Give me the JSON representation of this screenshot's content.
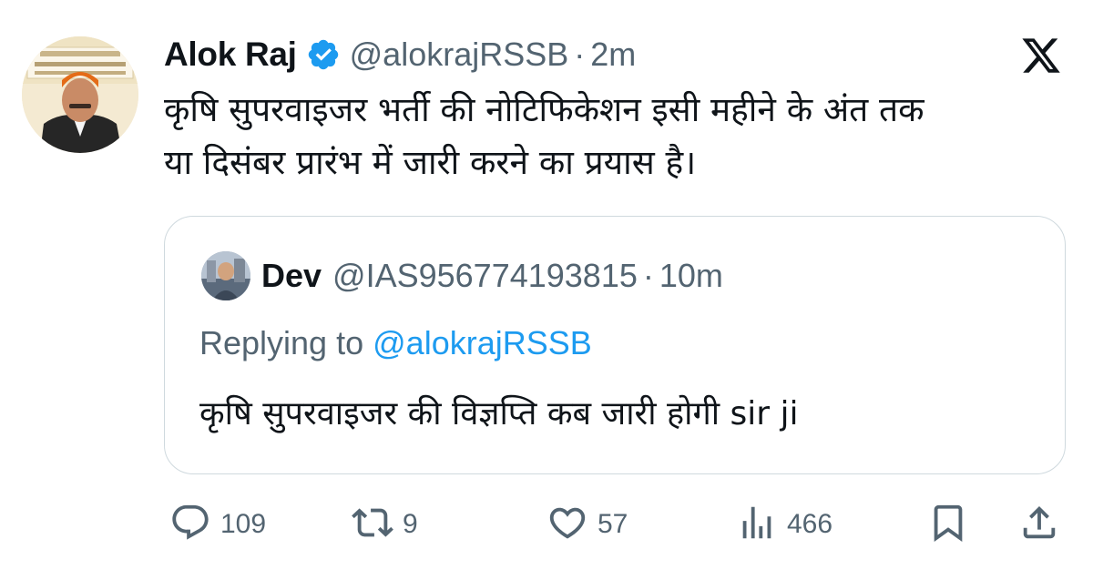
{
  "tweet": {
    "author_name": "Alok Raj",
    "handle": "@alokrajRSSB",
    "separator": "·",
    "time": "2m",
    "text_line1": "कृषि सुपरवाइजर भर्ती की नोटिफिकेशन इसी महीने के अंत तक",
    "text_line2": "या दिसंबर प्रारंभ में जारी करने का प्रयास है।"
  },
  "quoted": {
    "author_name": "Dev",
    "handle": "@IAS956774193815",
    "separator": "·",
    "time": "10m",
    "replying_prefix": "Replying to",
    "replying_handle": "@alokrajRSSB",
    "text": "कृषि सुपरवाइजर की विज्ञप्ति कब जारी होगी sir ji"
  },
  "actions": {
    "replies": "109",
    "reposts": "9",
    "likes": "57",
    "views": "466"
  },
  "icons": {
    "verified": "verified-badge-icon",
    "platform": "x-logo-icon",
    "reply": "reply-icon",
    "repost": "repost-icon",
    "like": "heart-icon",
    "views": "views-icon",
    "bookmark": "bookmark-icon",
    "share": "share-icon"
  },
  "colors": {
    "text": "#0f1419",
    "secondary": "#536471",
    "link": "#1d9bf0",
    "verified": "#1d9bf0",
    "border": "#cfd9de"
  }
}
